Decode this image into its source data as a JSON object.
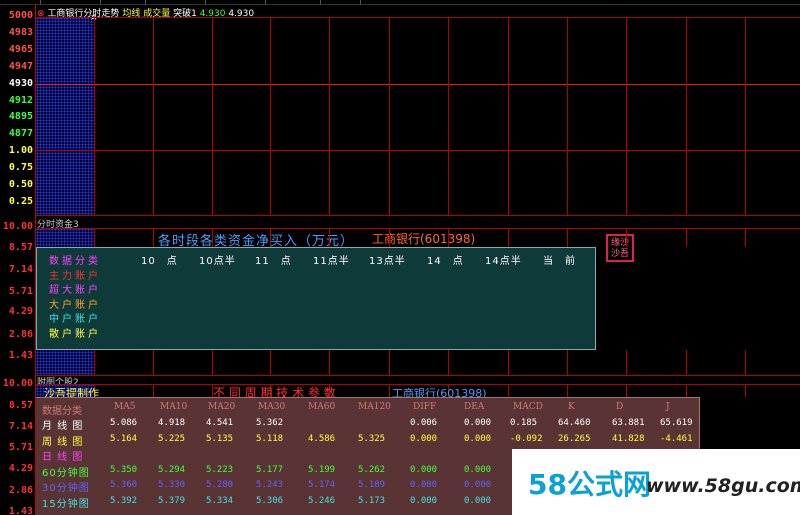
{
  "pane1": {
    "indicator": "工商银行分时走势",
    "avg_label": "均线",
    "volume_label": "成交量",
    "value_label": "突破1",
    "value1": "4.930",
    "value2": "4.930",
    "y_labels": [
      {
        "text": "5000",
        "color": "#ff5050"
      },
      {
        "text": "4983",
        "color": "#ff5050"
      },
      {
        "text": "4965",
        "color": "#ff5050"
      },
      {
        "text": "4947",
        "color": "#ff5050"
      },
      {
        "text": "4930",
        "color": "#ffffff"
      },
      {
        "text": "4912",
        "color": "#40ff40"
      },
      {
        "text": "4895",
        "color": "#40ff40"
      },
      {
        "text": "4877",
        "color": "#40ff40"
      },
      {
        "text": "1.00",
        "color": "#ffff40"
      },
      {
        "text": "0.75",
        "color": "#ffff40"
      },
      {
        "text": "0.50",
        "color": "#ffff40"
      },
      {
        "text": "0.25",
        "color": "#ffff40"
      }
    ]
  },
  "pane2": {
    "title": "分时资金3",
    "heading": "各时段各类资金净买入（万元）",
    "stock": "工商银行(601398)",
    "stamp": "缘沙沙吾",
    "y_labels": [
      "10.00",
      "8.57",
      "7.14",
      "5.71",
      "4.29",
      "2.86",
      "1.43"
    ],
    "columns": [
      "10　点",
      "10点半",
      "11　点",
      "11点半",
      "13点半",
      "14　点",
      "14点半",
      "当　前"
    ],
    "rows": [
      {
        "label": "数据分类",
        "color": "#ff40ff"
      },
      {
        "label": "主力账户",
        "color": "#ff3030"
      },
      {
        "label": "超大账户",
        "color": "#ff40ff"
      },
      {
        "label": "大户账户",
        "color": "#ffa020"
      },
      {
        "label": "中户账户",
        "color": "#40e0e0"
      },
      {
        "label": "散户账户",
        "color": "#ffff40"
      }
    ]
  },
  "pane3": {
    "title": "附图个股2",
    "author": "沙吾提制作",
    "heading": "不 同 周 期 技 术 参 数",
    "stock": "工商银行(601398)",
    "y_labels": [
      "10.00",
      "8.57",
      "7.14",
      "5.71",
      "4.29",
      "2.86",
      "1.43"
    ],
    "columns": [
      "数据分类",
      "MA5",
      "MA10",
      "MA20",
      "MA30",
      "MA60",
      "MA120",
      "DIFF",
      "DEA",
      "MACD",
      "K",
      "D",
      "J"
    ],
    "rows": [
      {
        "label": "月 线 图",
        "color": "#ffffff",
        "values": [
          "5.086",
          "4.918",
          "4.541",
          "5.362",
          "",
          "",
          "0.006",
          "0.000",
          "0.185",
          "64.460",
          "63.881",
          "65.619"
        ]
      },
      {
        "label": "周 线 图",
        "color": "#ffff40",
        "values": [
          "5.164",
          "5.225",
          "5.135",
          "5.118",
          "4.586",
          "5.325",
          "0.000",
          "0.000",
          "-0.092",
          "26.265",
          "41.828",
          "-4.461"
        ]
      },
      {
        "label": "日 线 图",
        "color": "#ff40ff",
        "values": [
          "",
          "",
          "",
          "",
          "",
          "",
          "",
          "",
          "",
          "",
          "",
          ""
        ]
      },
      {
        "label": "60分钟图",
        "color": "#40ff40",
        "values": [
          "5.350",
          "5.294",
          "5.223",
          "5.177",
          "5.199",
          "5.262",
          "0.000",
          "0.000",
          "",
          "",
          "",
          ""
        ]
      },
      {
        "label": "30分钟图",
        "color": "#6060ff",
        "values": [
          "5.360",
          "5.330",
          "5.280",
          "5.243",
          "5.174",
          "5.189",
          "0.000",
          "0.000",
          "",
          "",
          "",
          ""
        ]
      },
      {
        "label": "15分钟图",
        "color": "#40e0e0",
        "values": [
          "5.392",
          "5.379",
          "5.334",
          "5.306",
          "5.246",
          "5.173",
          "0.000",
          "0.000",
          "",
          "",
          "",
          ""
        ]
      }
    ]
  },
  "watermark": {
    "logo": "58公式网",
    "url": "www.58gu.com"
  }
}
